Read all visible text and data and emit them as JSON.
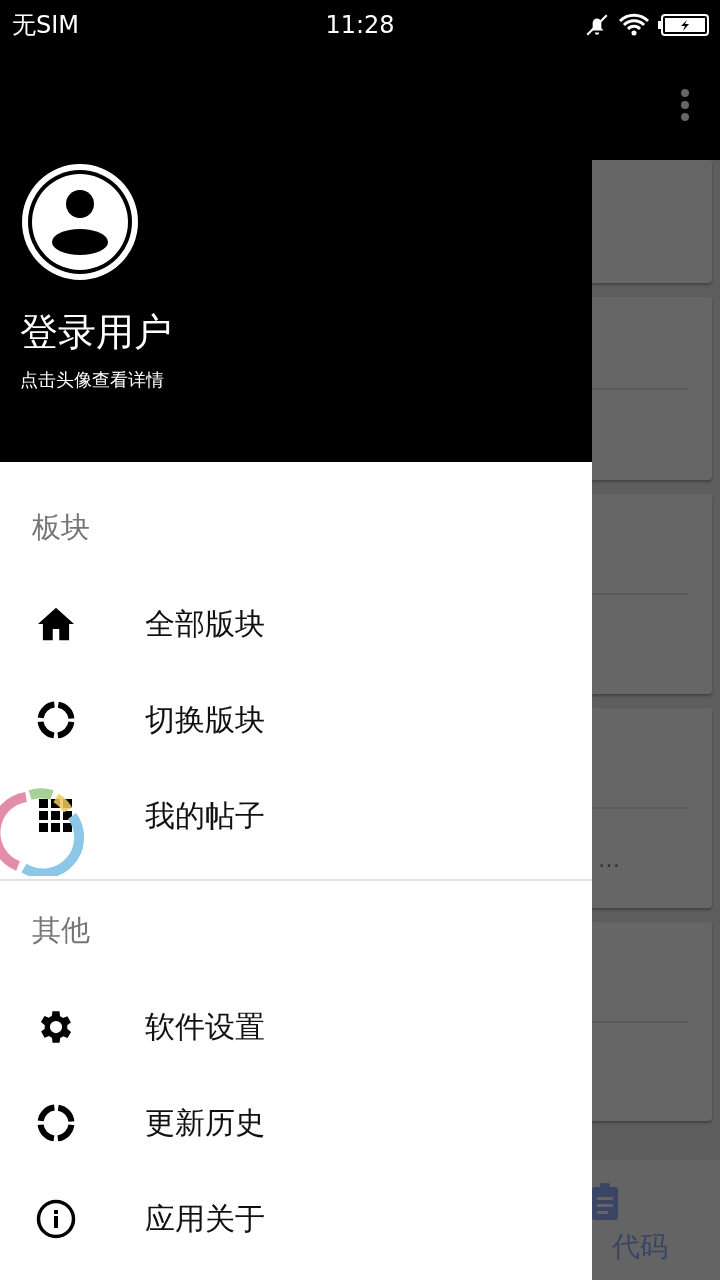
{
  "status_bar": {
    "carrier": "无SIM",
    "time": "11:28"
  },
  "drawer": {
    "header": {
      "name": "登录用户",
      "subtitle": "点击头像查看详情"
    },
    "sections": [
      {
        "title": "板块",
        "items": [
          {
            "label": "全部版块",
            "kind": "home"
          },
          {
            "label": "切换版块",
            "kind": "ring"
          },
          {
            "label": "我的帖子",
            "kind": "grid"
          }
        ]
      },
      {
        "title": "其他",
        "items": [
          {
            "label": "软件设置",
            "kind": "gear"
          },
          {
            "label": "更新历史",
            "kind": "ring"
          },
          {
            "label": "应用关于",
            "kind": "info"
          }
        ]
      }
    ]
  },
  "background": {
    "ellipsis": "…",
    "bottom_nav_label": "代码"
  }
}
